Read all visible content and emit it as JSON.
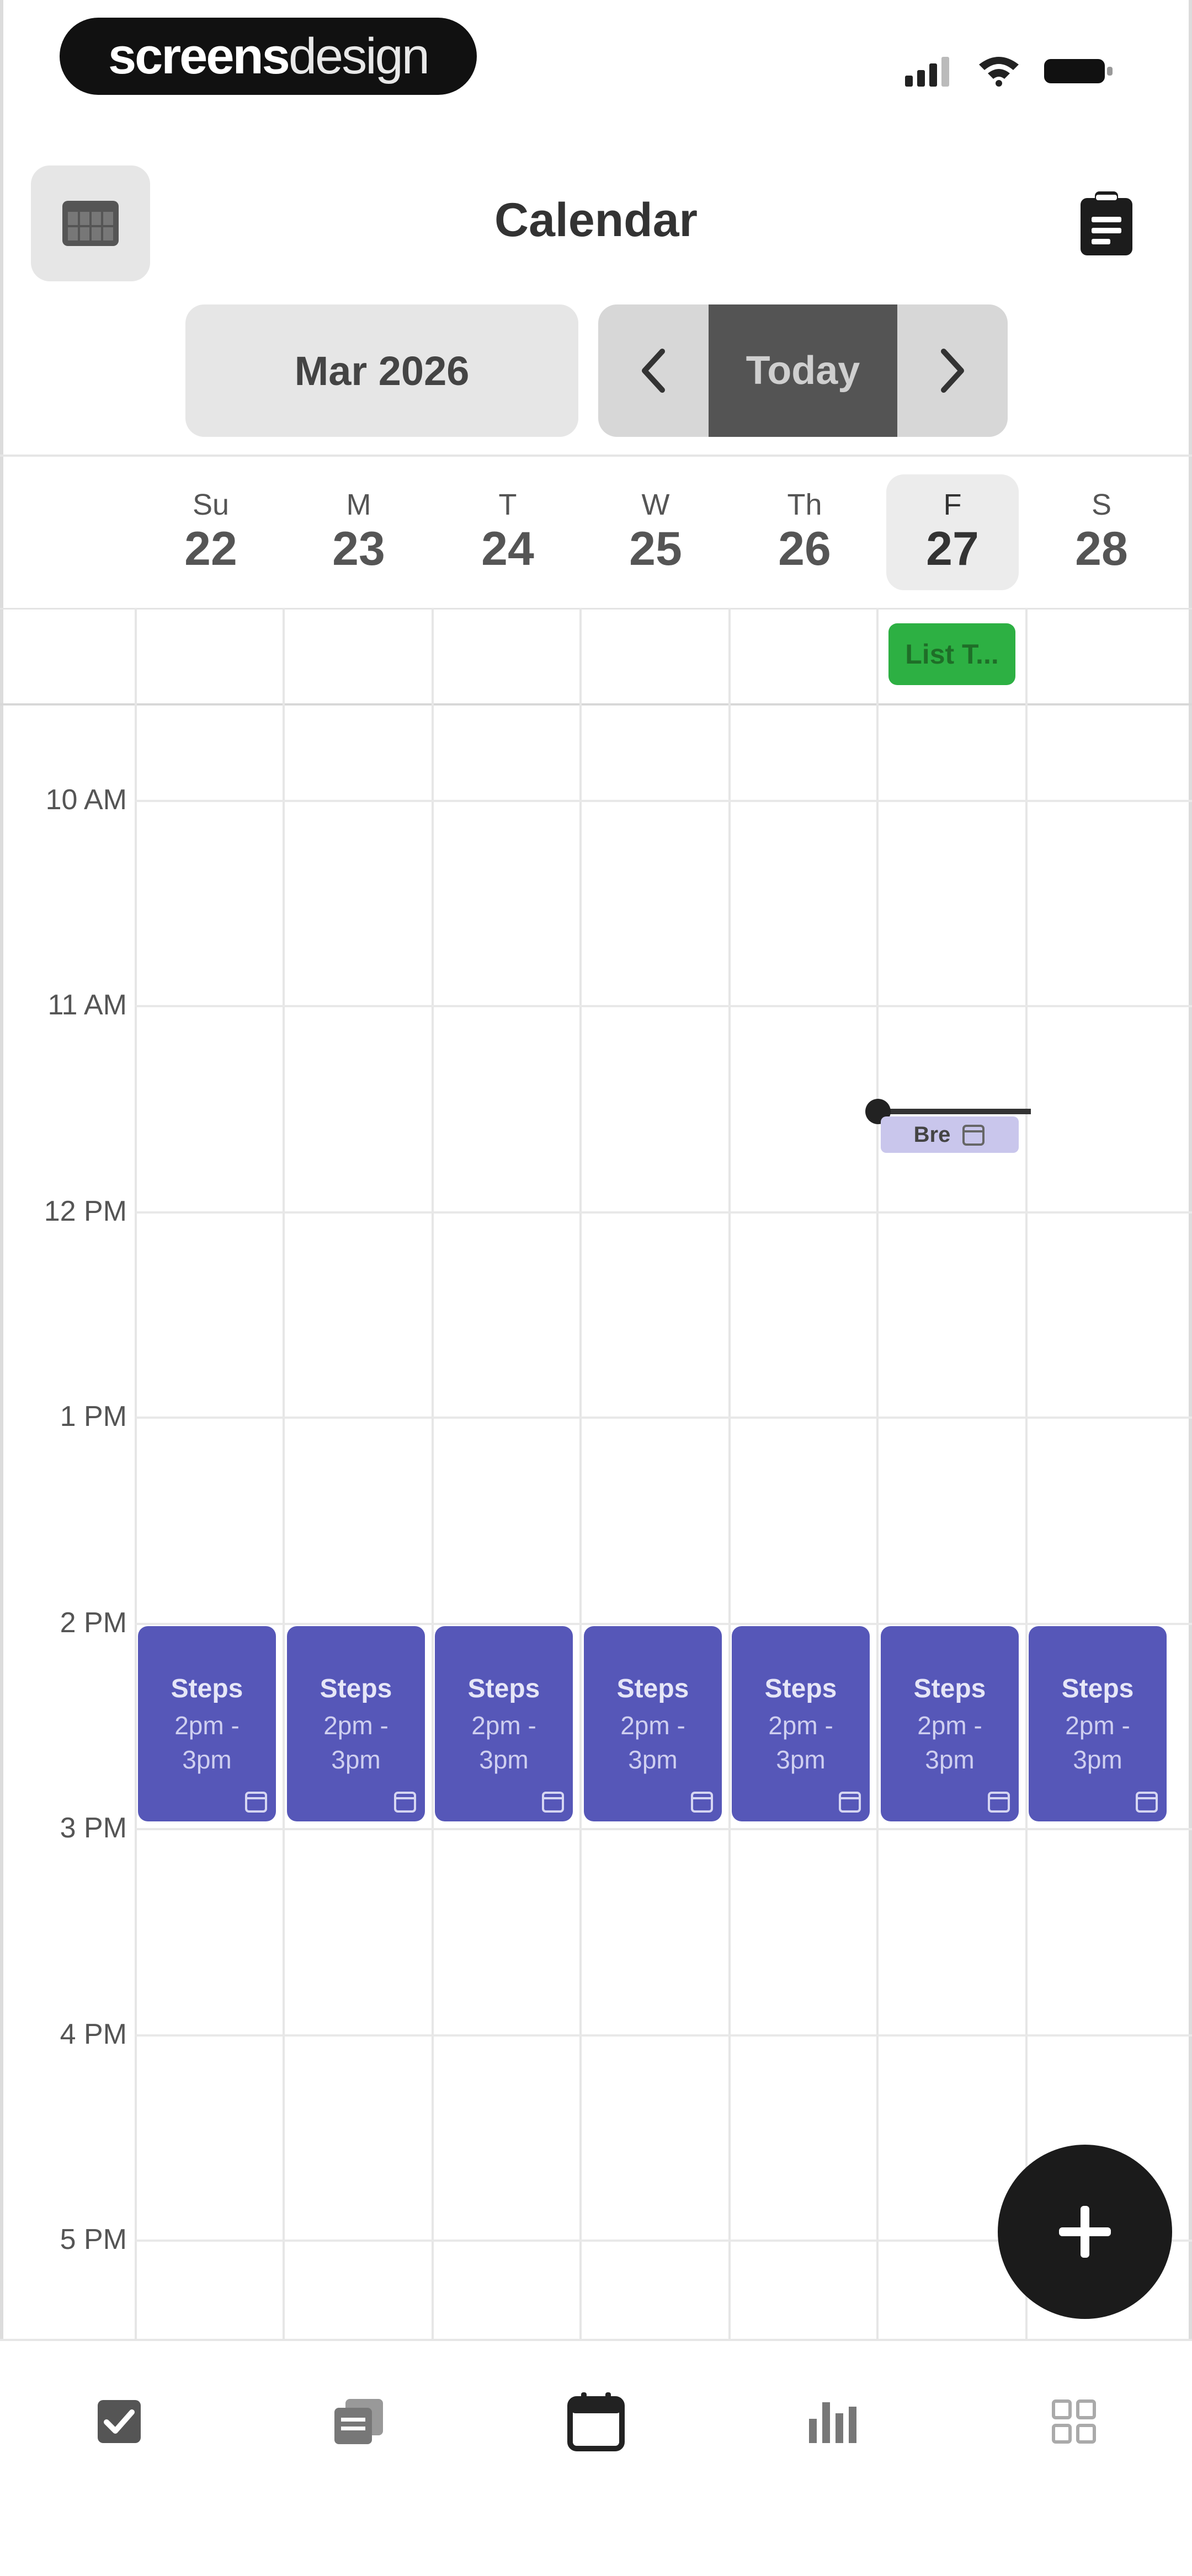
{
  "status_bar": {
    "brand_part1": "screens",
    "brand_part2": "design"
  },
  "header": {
    "title": "Calendar",
    "left_icon": "calendar-grid-icon",
    "right_icon": "clipboard-icon"
  },
  "navigation": {
    "month_label": "Mar 2026",
    "prev_icon": "chevron-left-icon",
    "today_label": "Today",
    "next_icon": "chevron-right-icon"
  },
  "days": [
    {
      "name": "Su",
      "number": "22"
    },
    {
      "name": "M",
      "number": "23"
    },
    {
      "name": "T",
      "number": "24"
    },
    {
      "name": "W",
      "number": "25"
    },
    {
      "name": "Th",
      "number": "26"
    },
    {
      "name": "F",
      "number": "27",
      "selected": true
    },
    {
      "name": "S",
      "number": "28"
    }
  ],
  "all_day_events": [
    {
      "label": "List T...",
      "day": "27",
      "color": "#2db043"
    }
  ],
  "time_labels": [
    "10 AM",
    "11 AM",
    "12 PM",
    "1 PM",
    "2 PM",
    "3 PM",
    "4 PM",
    "5 PM"
  ],
  "mini_event": {
    "label": "Bre"
  },
  "events": [
    {
      "title": "Steps",
      "time_line1": "2pm -",
      "time_line2": "3pm"
    },
    {
      "title": "Steps",
      "time_line1": "2pm -",
      "time_line2": "3pm"
    },
    {
      "title": "Steps",
      "time_line1": "2pm -",
      "time_line2": "3pm"
    },
    {
      "title": "Steps",
      "time_line1": "2pm -",
      "time_line2": "3pm"
    },
    {
      "title": "Steps",
      "time_line1": "2pm -",
      "time_line2": "3pm"
    },
    {
      "title": "Steps",
      "time_line1": "2pm -",
      "time_line2": "3pm"
    },
    {
      "title": "Steps",
      "time_line1": "2pm -",
      "time_line2": "3pm"
    }
  ],
  "event_color": "#5657b8",
  "fab_icon": "plus-icon",
  "tabs": [
    {
      "icon": "checklist-icon"
    },
    {
      "icon": "notes-icon"
    },
    {
      "icon": "calendar-icon",
      "active": true
    },
    {
      "icon": "stats-icon"
    },
    {
      "icon": "grid-icon"
    }
  ]
}
